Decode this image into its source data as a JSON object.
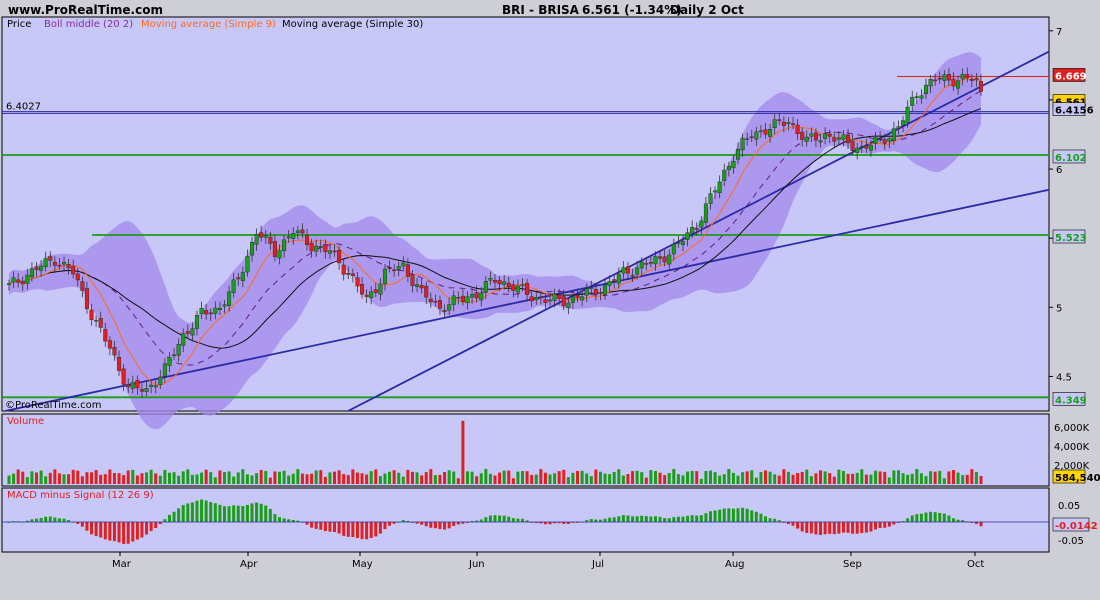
{
  "header": {
    "site": "www.ProRealTime.com",
    "title": "BRI - BRISA",
    "quote": "6.561 (-1.34%)",
    "period": "Daily  2 Oct"
  },
  "legend": {
    "price": "Price",
    "boll": "Boll middle (20 2)",
    "ma9": "Moving average (Simple 9)",
    "ma30": "Moving average (Simple 30)"
  },
  "watermark": "©ProRealTime.com",
  "volume_label": "Volume",
  "macd_label": "MACD minus Signal (12 26 9)",
  "colors": {
    "panel_bg": "#c8c8f8",
    "band": "#a488ec",
    "up": "#1a9e1a",
    "down": "#e02020",
    "ma9": "#ff6a1a",
    "ma30": "#101010",
    "boll": "#602070",
    "trend": "#2a2aa8",
    "level": "#1a9e1a"
  },
  "chart_data": [
    {
      "type": "candlestick",
      "title": "BRI - BRISA",
      "ylim": [
        4.25,
        7.1
      ],
      "y_ticks": [
        "7",
        "6.5",
        "6",
        "5.5",
        "5",
        "4.5"
      ],
      "x_months": [
        "Mar",
        "Apr",
        "May",
        "Jun",
        "Jul",
        "Aug",
        "Sep",
        "Oct"
      ],
      "last_price": "6.561",
      "levels": [
        {
          "label": "6.4027",
          "value": 6.4027,
          "color": "#2a2aa8"
        },
        {
          "label": "6.4156",
          "value": 6.4156,
          "color": "#2a2aa8"
        },
        {
          "label": "6.102",
          "value": 6.102,
          "color": "#1a9e1a"
        },
        {
          "label": "5.523",
          "value": 5.523,
          "color": "#1a9e1a"
        },
        {
          "label": "4.349",
          "value": 4.349,
          "color": "#1a9e1a"
        }
      ],
      "resistance": {
        "value": 6.67,
        "label": "6.669"
      }
    },
    {
      "type": "bar",
      "title": "Volume",
      "y_ticks": [
        "6,000K",
        "4,000K",
        "2,000K"
      ],
      "last_value": "584,540"
    },
    {
      "type": "bar",
      "title": "MACD minus Signal (12 26 9)",
      "y_ticks": [
        "0.05",
        "-0.05"
      ],
      "last_value": "-0.0142"
    }
  ]
}
